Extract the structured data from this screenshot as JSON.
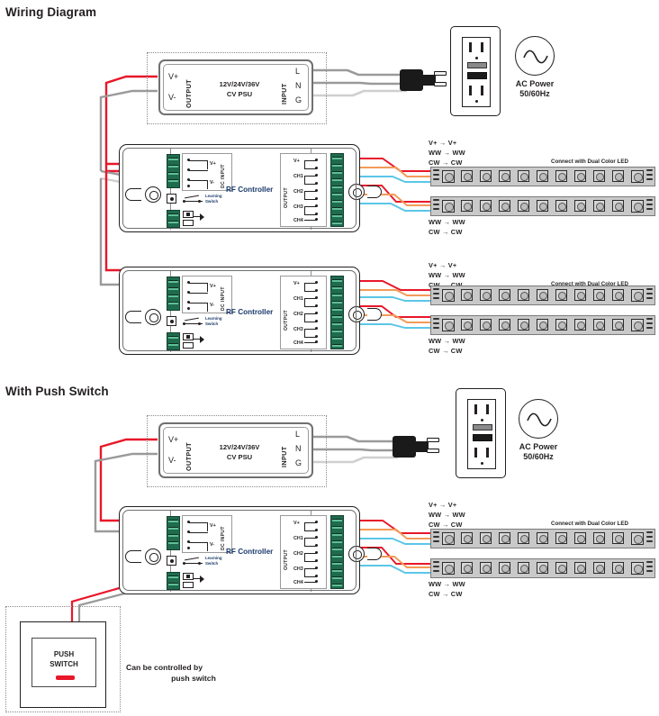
{
  "page": {
    "sections": [
      {
        "id": "wiring",
        "title": "Wiring Diagram"
      },
      {
        "id": "push",
        "title": "With Push Switch"
      }
    ]
  },
  "psu": {
    "title_line1": "12V/24V/36V",
    "title_line2": "CV PSU",
    "output_label": "OUTPUT",
    "input_label": "INPUT",
    "output_pins": [
      "V+",
      "V-"
    ],
    "input_pins": [
      "L",
      "N",
      "G"
    ]
  },
  "power": {
    "ac_line1": "AC Power",
    "ac_line2": "50/60Hz",
    "ac_symbol": "sine-wave"
  },
  "controller": {
    "name": "RF Controller",
    "input_label": "DC INPUT",
    "input_pins": [
      "V+",
      "V-"
    ],
    "output_label": "OUTPUT",
    "output_pins": [
      "V+",
      "CH1",
      "CH2",
      "CH3",
      "CH4"
    ],
    "learning_switch_line1": "Learning",
    "learning_switch_line2": "Switch",
    "push_switch_port": "Push Switch"
  },
  "led": {
    "connect_note": "Connect with Dual Color LED",
    "map_top": [
      "V+  →  V+",
      "WW  →  WW",
      "CW  →  CW"
    ],
    "map_bottom": [
      "WW  →  WW",
      "CW  →  CW"
    ]
  },
  "push_switch": {
    "label_line1": "PUSH",
    "label_line2": "SWITCH",
    "note_line1": "Can be controlled by",
    "note_line2": "push switch"
  },
  "colors": {
    "wire_positive": "#e8172a",
    "wire_neutral": "#9a9a9a",
    "wire_ground": "#c9c9c9",
    "wire_ww": "#f39b58",
    "wire_cw": "#5bc6e8",
    "terminal_green": "#1f6b4e",
    "brand_blue": "#1b3a6b",
    "ink": "#231f20"
  }
}
